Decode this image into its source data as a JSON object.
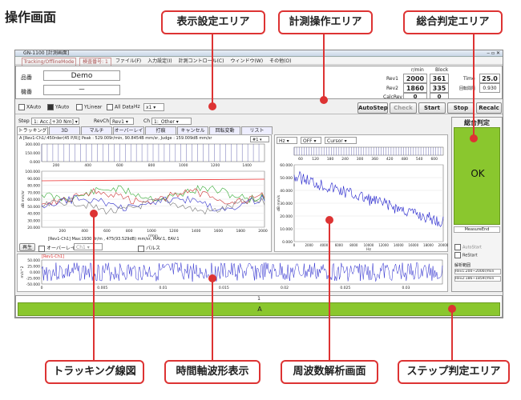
{
  "page_title": "操作画面",
  "callouts": {
    "display": "表示設定エリア",
    "measure": "計測操作エリア",
    "judge": "総合判定エリア",
    "tracking": "トラッキング線図",
    "time": "時間軸波形表示",
    "freq": "周波数解析画面",
    "step": "ステップ判定エリア"
  },
  "window": {
    "title": "GN-1100 [計測画面]",
    "mode_tab": "Tracking/OfflineMode",
    "sample_tab": "検査番号: 1",
    "menu": [
      "ファイル(F)",
      "入力設定(I)",
      "計測コントロール(C)",
      "ウィンドウ(W)",
      "その他(O)"
    ]
  },
  "info": {
    "product_label": "品番",
    "product_value": "Demo",
    "serial_label": "機番",
    "serial_value": "－",
    "col_rmin": "r/min",
    "col_block": "Block",
    "rows": [
      {
        "label": "Rev1",
        "rmin": "2000",
        "block": "361"
      },
      {
        "label": "Rev2",
        "rmin": "1860",
        "block": "335"
      },
      {
        "label": "CalcRev",
        "rmin": "0",
        "block": "0"
      }
    ],
    "time_label": "Time",
    "time_value": "25.0",
    "interval_label": "回転間隔",
    "interval_value": "0.930"
  },
  "controls": {
    "xauto": "XAuto",
    "yauto": "YAuto",
    "ylinear": "YLinear",
    "alldata": "All Data",
    "hz_label": "Hz",
    "hz_value": "x1",
    "autostep": "AutoStep",
    "check": "Check",
    "start": "Start",
    "stop": "Stop",
    "recalc": "Recalc"
  },
  "selectors": {
    "step_label": "Step",
    "step_value": "1: Acc.[+30 Nm]",
    "revch_label": "RevCh",
    "revch_value": "Rev1",
    "ch_label": "Ch",
    "ch_value": "1:_Other"
  },
  "tabs": [
    "トラッキング",
    "3D",
    "マルチ",
    "オーバーレイ",
    "打痕",
    "キャンセル",
    "回転変動",
    "リスト"
  ],
  "tracking": {
    "info": "A [Rev1-Ch1/:450rder(45 P/R)] Peak : 529.009r/min, 90.8454B mm/sr, Judge : 159.009dB mm/sr",
    "dropdown": "#1",
    "upper_yticks": [
      "300.000",
      "150.000",
      "0.000"
    ],
    "upper_xticks": [
      "200",
      "400",
      "600",
      "800",
      "1000",
      "1200",
      "1400"
    ],
    "ylabel": "dB mm/sr",
    "yticks": [
      "100.000",
      "90.000",
      "80.000",
      "70.000",
      "60.000",
      "50.000",
      "40.000",
      "30.000",
      "20.000"
    ],
    "xticks": [
      "200",
      "400",
      "600",
      "800",
      "1000",
      "1200",
      "1400",
      "1600",
      "1800",
      "2000"
    ],
    "xlabel": "r/min",
    "status": "[Rev1-Ch1] Max:1930 8r/m , 475(93.529dB) mm/sr, MAV:1, EAV:1",
    "play": "再生",
    "overlay": "オーバーレイ",
    "overlay_ch": "Ch1",
    "pulse": "パルス"
  },
  "freq": {
    "sel1": "Hz",
    "sel2": "OFF",
    "sel3": "Cursor",
    "upper_xticks": [
      "60",
      "120",
      "180",
      "240",
      "300",
      "360",
      "420",
      "480",
      "540",
      "600"
    ],
    "ylabel": "dB mm/s",
    "yticks": [
      "60.000",
      "50.000",
      "40.000",
      "30.000",
      "20.000",
      "10.000",
      "0.000"
    ],
    "xticks": [
      "0",
      "2000",
      "4000",
      "6000",
      "8000",
      "10000",
      "12000",
      "14000",
      "16000",
      "18000",
      "20000"
    ],
    "xlabel": "Hz"
  },
  "time": {
    "label": "[Rev1-Ch1]",
    "ylabel": "m/s^2",
    "yticks": [
      "50.000",
      "25.000",
      "0.000",
      "-25.000",
      "-50.000"
    ],
    "xticks": [
      "0",
      "0.005",
      "0.01",
      "0.015",
      "0.02",
      "0.025",
      "0.03"
    ],
    "xlabel": "s"
  },
  "judge": {
    "title": "総合判定",
    "result": "OK",
    "measure_end": "MeasureEnd",
    "autostart": "AutoStart",
    "restart": "ReStart",
    "range_label": "解析範囲",
    "range1": "Rev1:200~2000r/min",
    "range2": "Rev2:186~1859r/min"
  },
  "step_area": {
    "number": "1",
    "result": "A"
  },
  "colors": {
    "ok_green": "#8ac72e",
    "callout_red": "#dd3333"
  }
}
